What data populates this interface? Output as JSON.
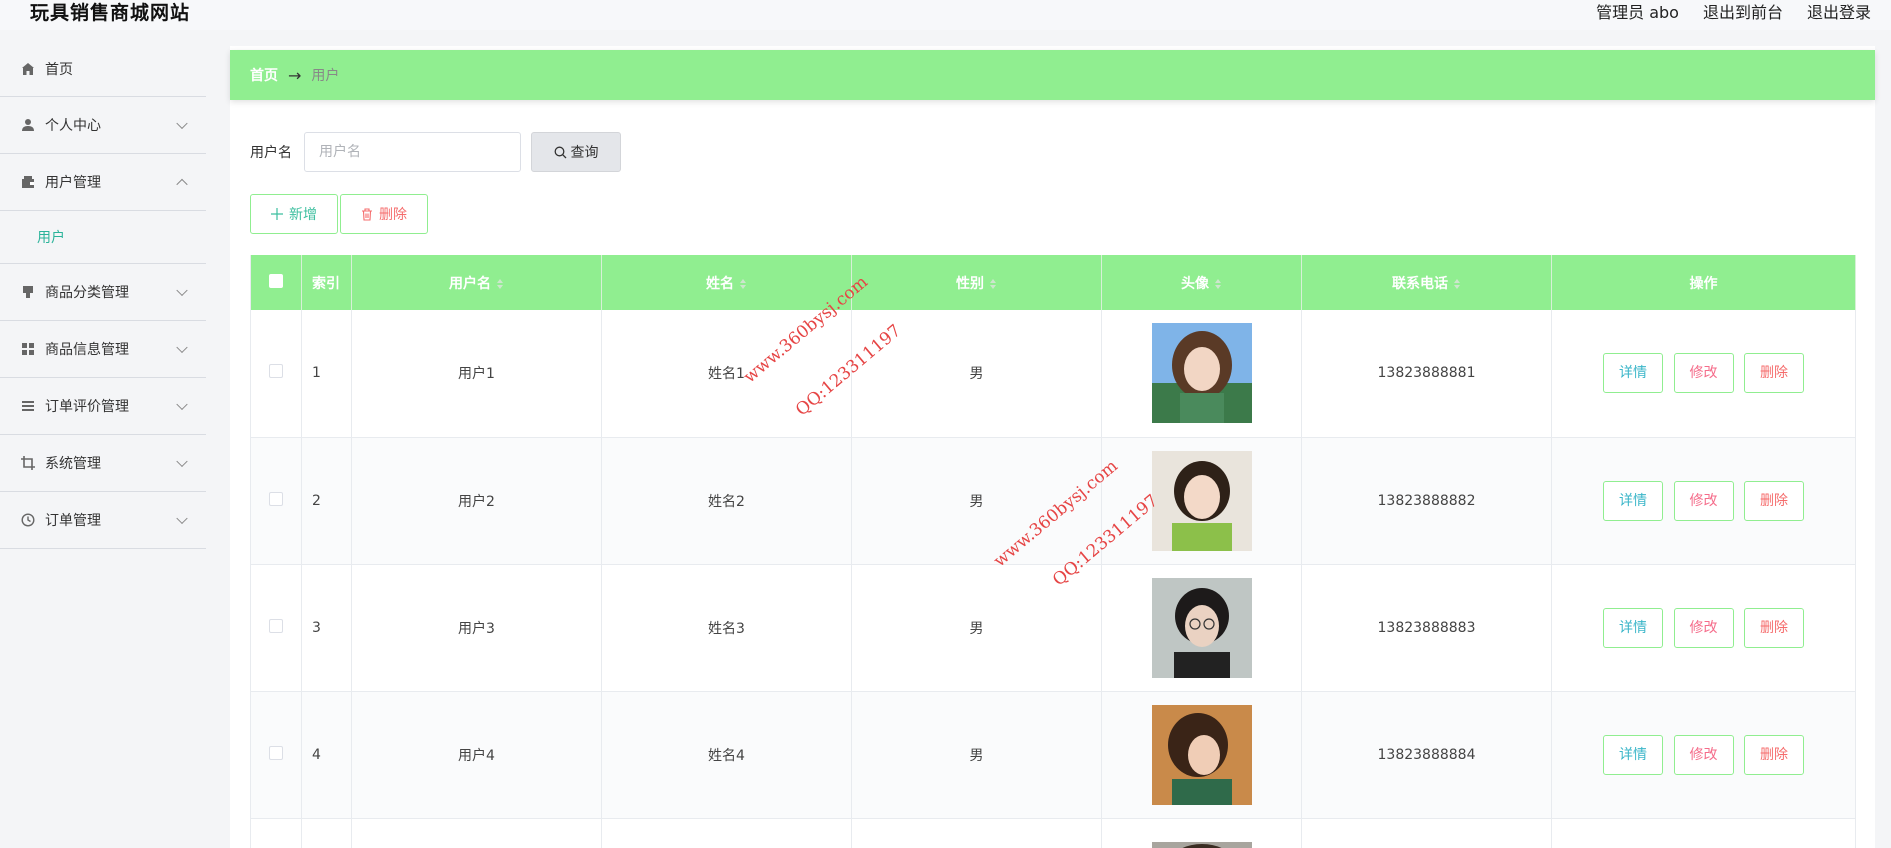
{
  "app": {
    "title": "玩具销售商城网站",
    "header_links": [
      "管理员 abo",
      "退出到前台",
      "退出登录"
    ]
  },
  "sidebar": {
    "items": [
      {
        "label": "首页",
        "icon": "home-icon",
        "has_arrow": false
      },
      {
        "label": "个人中心",
        "icon": "user-icon",
        "has_arrow": true
      },
      {
        "label": "用户管理",
        "icon": "wallet-icon",
        "has_arrow": true,
        "expanded": true,
        "children": [
          "用户"
        ]
      },
      {
        "label": "商品分类管理",
        "icon": "stamp-icon",
        "has_arrow": true
      },
      {
        "label": "商品信息管理",
        "icon": "grid-icon",
        "has_arrow": true
      },
      {
        "label": "订单评价管理",
        "icon": "list-icon",
        "has_arrow": true
      },
      {
        "label": "系统管理",
        "icon": "crop-icon",
        "has_arrow": true
      },
      {
        "label": "订单管理",
        "icon": "clock-icon",
        "has_arrow": true
      }
    ]
  },
  "breadcrumb": {
    "home": "首页",
    "separator": "→",
    "current": "用户"
  },
  "search": {
    "label": "用户名",
    "placeholder": "用户名",
    "value": "",
    "button": "查询"
  },
  "actions": {
    "add": "新增",
    "delete": "删除"
  },
  "table": {
    "columns": [
      "索引",
      "用户名",
      "姓名",
      "性别",
      "头像",
      "联系电话",
      "操作"
    ],
    "rows": [
      {
        "index": "1",
        "username": "用户1",
        "name": "姓名1",
        "gender": "男",
        "phone": "13823888881"
      },
      {
        "index": "2",
        "username": "用户2",
        "name": "姓名2",
        "gender": "男",
        "phone": "13823888882"
      },
      {
        "index": "3",
        "username": "用户3",
        "name": "姓名3",
        "gender": "男",
        "phone": "13823888883"
      },
      {
        "index": "4",
        "username": "用户4",
        "name": "姓名4",
        "gender": "男",
        "phone": "13823888884"
      }
    ],
    "row_actions": {
      "detail": "详情",
      "edit": "修改",
      "delete": "删除"
    }
  },
  "watermark": {
    "site": "www.360bysj.com",
    "qq": "QQ:123311197"
  },
  "colors": {
    "accent": "#90ee90",
    "menu_active": "#2bb39a",
    "danger": "#f56c6c",
    "watermark": "#e64545"
  }
}
